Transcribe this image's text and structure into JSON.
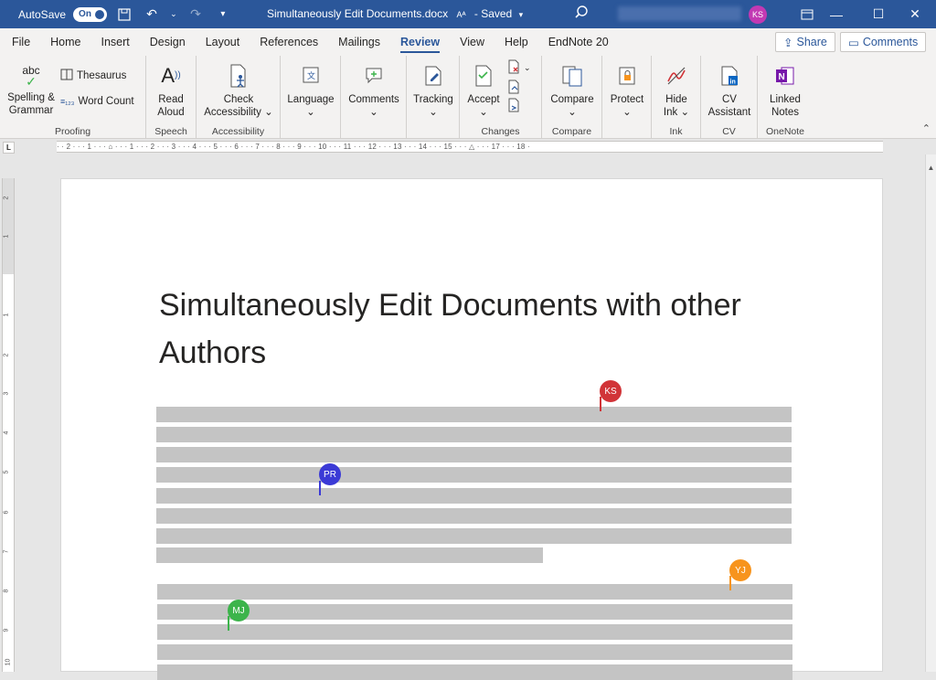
{
  "titlebar": {
    "autosave_label": "AutoSave",
    "autosave_state": "On",
    "doc_title": "Simultaneously Edit Documents.docx",
    "saved_status": "- Saved",
    "user_initials": "KS"
  },
  "menu": {
    "tabs": [
      "File",
      "Home",
      "Insert",
      "Design",
      "Layout",
      "References",
      "Mailings",
      "Review",
      "View",
      "Help",
      "EndNote 20"
    ],
    "active": "Review",
    "share_label": "Share",
    "comments_label": "Comments"
  },
  "ribbon": {
    "proofing": {
      "spelling_line1": "Spelling &",
      "spelling_line2": "Grammar",
      "spelling_icon_text": "abc",
      "thesaurus": "Thesaurus",
      "word_count": "Word Count",
      "label": "Proofing"
    },
    "speech": {
      "read_aloud_line1": "Read",
      "read_aloud_line2": "Aloud",
      "label": "Speech"
    },
    "accessibility": {
      "check_line1": "Check",
      "check_line2": "Accessibility",
      "label": "Accessibility"
    },
    "language": {
      "label": "Language"
    },
    "comments": {
      "label": "Comments"
    },
    "tracking": {
      "label": "Tracking"
    },
    "changes": {
      "accept": "Accept",
      "label": "Changes"
    },
    "compare": {
      "compare": "Compare",
      "label": "Compare"
    },
    "protect": {
      "protect": "Protect"
    },
    "ink": {
      "hide_line1": "Hide",
      "hide_line2": "Ink",
      "label": "Ink"
    },
    "cv": {
      "cv_line1": "CV",
      "cv_line2": "Assistant",
      "label": "CV"
    },
    "onenote": {
      "linked_line1": "Linked",
      "linked_line2": "Notes",
      "label": "OneNote"
    }
  },
  "ruler": {
    "corner": "L",
    "marks": "· · 2 · · · 1 · · · ⌂ · · · 1 · · · 2 · · · 3 · · · 4 · · · 5 · · · 6 · · · 7 · · · 8 · · · 9 · · · 10 · · · 11 · · · 12 · · · 13 · · · 14 · · · 15 · · · △ · · · 17 · · · 18 ·",
    "vertical_marks": [
      "2",
      "1",
      "1",
      "2",
      "3",
      "4",
      "5",
      "6",
      "7",
      "8",
      "9",
      "10"
    ]
  },
  "document": {
    "title": "Simultaneously Edit Documents with other Authors",
    "collaborators": [
      {
        "initials": "KS",
        "color": "#d13438"
      },
      {
        "initials": "PR",
        "color": "#3b3ad6"
      },
      {
        "initials": "YJ",
        "color": "#f7941d"
      },
      {
        "initials": "MJ",
        "color": "#3cb44b"
      }
    ]
  }
}
